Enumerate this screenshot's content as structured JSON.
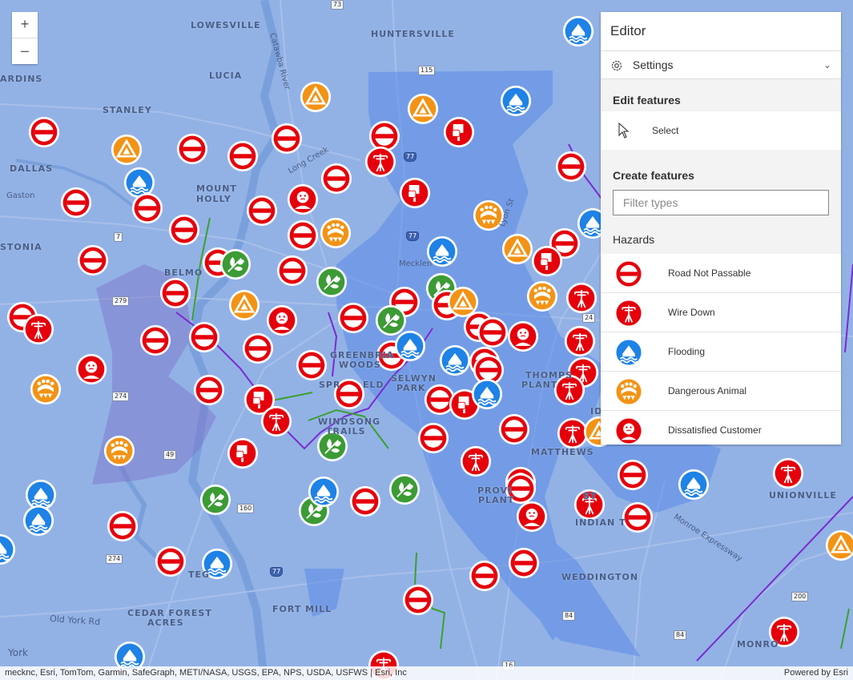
{
  "colors": {
    "road_not_passable": "#e5000b",
    "wire_down": "#e5000b",
    "flooding": "#1e82e6",
    "dangerous_animal": "#f39315",
    "dissatisfied_customer": "#e5000b",
    "hazard_warning": "#f39315",
    "vegetation": "#3c9b35",
    "protest": "#e5000b"
  },
  "zoom": {
    "in_label": "+",
    "out_label": "–"
  },
  "places": [
    {
      "label": "LOWESVILLE"
    },
    {
      "label": "HUNTERSVILLE"
    },
    {
      "label": "LUCIA"
    },
    {
      "label": "ARDINS"
    },
    {
      "label": "STANLEY"
    },
    {
      "label": "DALLAS"
    },
    {
      "label": "Gaston"
    },
    {
      "label": "MOUNT"
    },
    {
      "label": "HOLLY"
    },
    {
      "label": "STONIA"
    },
    {
      "label": "BELMO"
    },
    {
      "label": "GREENBRIA"
    },
    {
      "label": "WOODS"
    },
    {
      "label": "SPR"
    },
    {
      "label": "ELD"
    },
    {
      "label": "SELWYN"
    },
    {
      "label": "PARK"
    },
    {
      "label": "THOMPS"
    },
    {
      "label": "PLANT"
    },
    {
      "label": "WINDSONG"
    },
    {
      "label": "TRAILS"
    },
    {
      "label": "MATTHEWS"
    },
    {
      "label": "PROVI"
    },
    {
      "label": "PLANT"
    },
    {
      "label": "ST"
    },
    {
      "label": "INDIAN T"
    },
    {
      "label": "UNIONVILLE"
    },
    {
      "label": "WEDDINGTON"
    },
    {
      "label": "CEDAR FOREST"
    },
    {
      "label": "ACRES"
    },
    {
      "label": "FORT MILL"
    },
    {
      "label": "TEG"
    },
    {
      "label": "MONRO"
    },
    {
      "label": "York"
    },
    {
      "label": "Mecklen"
    },
    {
      "label": "ID"
    }
  ],
  "road_labels": [
    {
      "label": "Old York Rd"
    },
    {
      "label": "Catawba River"
    },
    {
      "label": "Long Creek"
    },
    {
      "label": "Monroe Expressway"
    },
    {
      "label": "Lyon St"
    }
  ],
  "shields": [
    {
      "label": "73"
    },
    {
      "label": "115"
    },
    {
      "label": "77"
    },
    {
      "label": "77"
    },
    {
      "label": "7"
    },
    {
      "label": "279"
    },
    {
      "label": "274"
    },
    {
      "label": "49"
    },
    {
      "label": "160"
    },
    {
      "label": "274"
    },
    {
      "label": "77"
    },
    {
      "label": "84"
    },
    {
      "label": "200"
    },
    {
      "label": "84"
    },
    {
      "label": "16"
    },
    {
      "label": "24"
    }
  ],
  "editor": {
    "title": "Editor",
    "settings_label": "Settings",
    "edit_features_heading": "Edit features",
    "select_label": "Select",
    "create_features_heading": "Create features",
    "filter_placeholder": "Filter types",
    "category": "Hazards",
    "types": [
      {
        "label": "Road Not Passable",
        "icon": "road-not-passable-icon"
      },
      {
        "label": "Wire Down",
        "icon": "wire-down-icon"
      },
      {
        "label": "Flooding",
        "icon": "flooding-icon"
      },
      {
        "label": "Dangerous Animal",
        "icon": "dangerous-animal-icon"
      },
      {
        "label": "Dissatisfied Customer",
        "icon": "dissatisfied-customer-icon"
      }
    ]
  },
  "attribution": {
    "text": "mecknc, Esri, TomTom, Garmin, SafeGraph, METI/NASA, USGS, EPA, NPS, USDA, USFWS | Esri, Inc",
    "powered_by": "Powered by Esri"
  }
}
